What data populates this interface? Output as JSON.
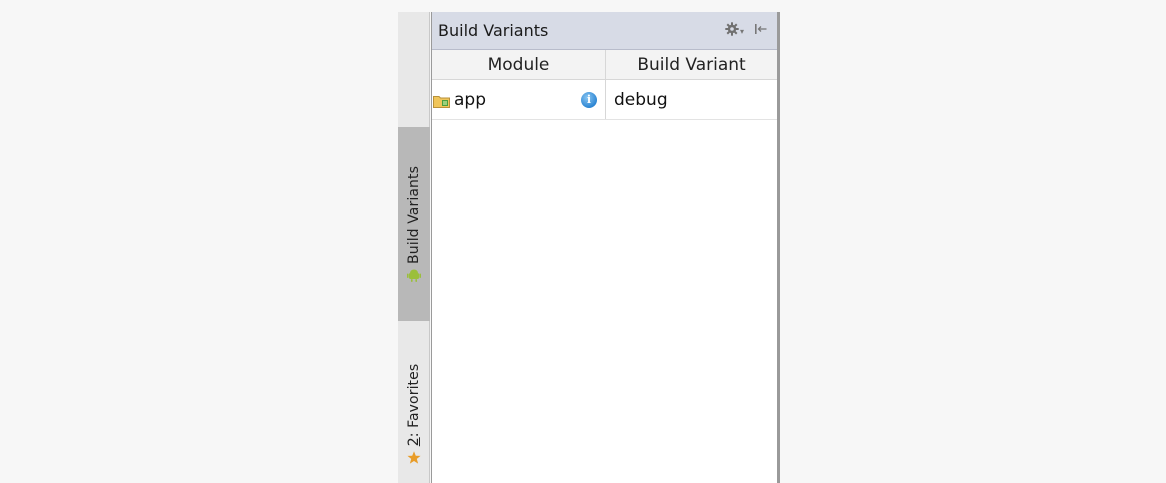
{
  "tool_strip": {
    "tabs": [
      {
        "label": "Build Variants",
        "icon": "android-icon",
        "active": true
      },
      {
        "label_prefix": "2",
        "label_rest": ": Favorites",
        "icon": "star-icon",
        "active": false
      }
    ]
  },
  "panel": {
    "title": "Build Variants",
    "actions": [
      "gear-icon",
      "hide-panel-icon"
    ]
  },
  "table": {
    "columns": [
      "Module",
      "Build Variant"
    ],
    "rows": [
      {
        "module": "app",
        "variant": "debug"
      }
    ]
  },
  "colors": {
    "header_bg": "#d7dbe6",
    "active_tab_bg": "#b8b8b8",
    "android_green": "#9bbf3b",
    "favorite_star": "#e89c28"
  }
}
